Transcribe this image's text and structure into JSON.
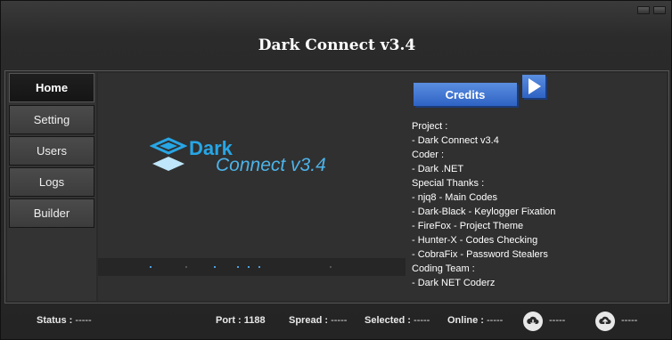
{
  "window": {
    "title": "Dark Connect v3.4"
  },
  "nav": [
    {
      "label": "Home",
      "active": true
    },
    {
      "label": "Setting"
    },
    {
      "label": "Users"
    },
    {
      "label": "Logs"
    },
    {
      "label": "Builder"
    }
  ],
  "logo": {
    "line1": "Dark",
    "line2": "Connect v3.4",
    "color": "#27a6e6"
  },
  "credits": {
    "button_label": "Credits",
    "lines": [
      "Project :",
      "- Dark Connect v3.4",
      "Coder :",
      "- Dark .NET",
      "Special Thanks :",
      "- njq8 - Main Codes",
      "- Dark-Black - Keylogger Fixation",
      "- FireFox - Project Theme",
      "- Hunter-X - Codes Checking",
      "- CobraFix - Password Stealers",
      "Coding Team :",
      "- Dark NET Coderz"
    ]
  },
  "status": {
    "status_label": "Status :",
    "status_value": "-----",
    "port_label": "Port :",
    "port_value": "1188",
    "spread_label": "Spread :",
    "spread_value": "-----",
    "selected_label": "Selected :",
    "selected_value": "-----",
    "online_label": "Online :",
    "online_value": "-----",
    "download_value": "-----",
    "upload_value": "-----"
  },
  "icons": {
    "download": "cloud-download-icon",
    "upload": "cloud-upload-icon",
    "credits_arrow": "play-arrow-icon"
  }
}
